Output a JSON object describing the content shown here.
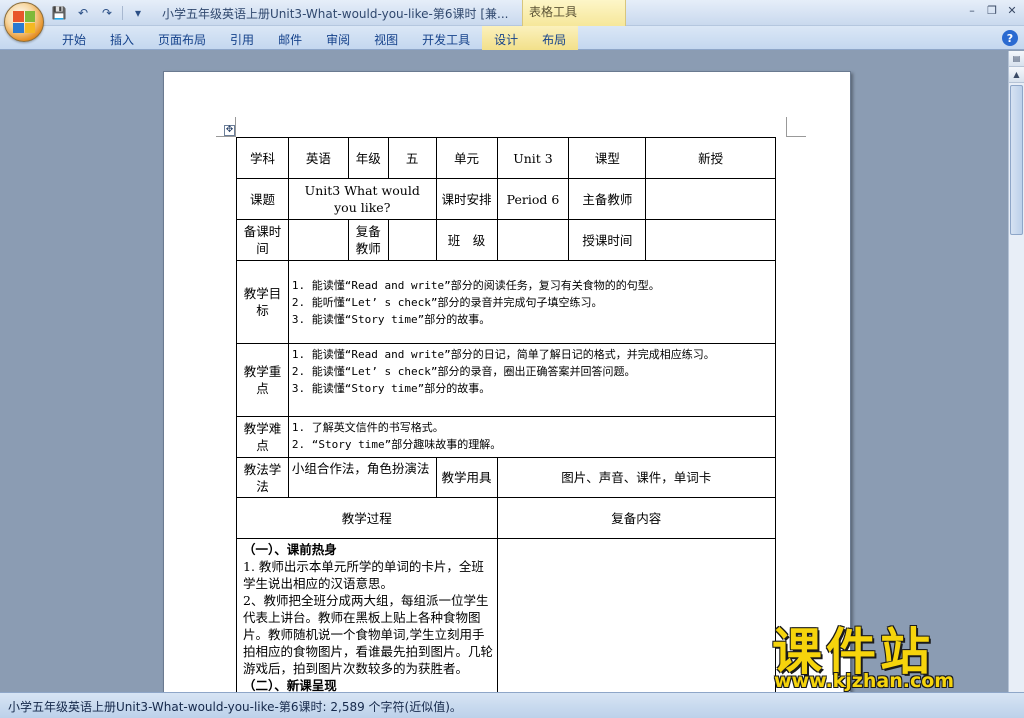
{
  "app": {
    "title": "小学五年级英语上册Unit3-What-would-you-like-第6课时 [兼...",
    "context_tab_group": "表格工具"
  },
  "ribbon": {
    "tabs": [
      "开始",
      "插入",
      "页面布局",
      "引用",
      "邮件",
      "审阅",
      "视图",
      "开发工具",
      "设计",
      "布局"
    ]
  },
  "table": {
    "subject_label": "学科",
    "subject_value": "英语",
    "grade_label": "年级",
    "grade_value": "五",
    "unit_label": "单元",
    "unit_value": "Unit 3",
    "type_label": "课型",
    "type_value": "新授",
    "topic_label": "课题",
    "topic_value": "Unit3 What would you like?",
    "period_label": "课时安排",
    "period_value": "Period 6",
    "teacher_label": "主备教师",
    "prep_time_label": "备课时间",
    "review_teacher_label": "复备教师",
    "class_label": "班　级",
    "teach_time_label": "授课时间",
    "goals_label": "教学目标",
    "goals": [
      "1. 能读懂“Read and write”部分的阅读任务，复习有关食物的的句型。",
      "2. 能听懂“Let’ s check”部分的录音并完成句子填空练习。",
      "3. 能读懂“Story time”部分的故事。"
    ],
    "key_points_label": "教学重点",
    "key_points": [
      "1. 能读懂“Read and write”部分的日记，简单了解日记的格式，并完成相应练习。",
      "2. 能读懂“Let’ s check”部分的录音，圈出正确答案并回答问题。",
      "3. 能读懂“Story time”部分的故事。"
    ],
    "difficulties_label": "教学难点",
    "difficulties": [
      "1. 了解英文信件的书写格式。",
      "2. “Story time”部分趣味故事的理解。"
    ],
    "method_label": "教法学法",
    "method_value": "小组合作法，角色扮演法",
    "tools_label": "教学用具",
    "tools_value": "图片、声音、课件，单词卡",
    "process_label": "教学过程",
    "review_label": "复备内容",
    "section1_title": "（一）、课前热身",
    "section1_p1": "1. 教师出示本单元所学的单词的卡片，全班学生说出相应的汉语意思。",
    "section1_p2": "2、教师把全班分成两大组，每组派一位学生代表上讲台。教师在黑板上贴上各种食物图片。教师随机说一个食物单词,学生立刻用手拍相应的食物图片，看谁最先拍到图片。几轮游戏后，拍到图片次数较多的为获胜者。",
    "section2_title": "（二）、新课呈现"
  },
  "status": {
    "text": "小学五年级英语上册Unit3-What-would-you-like-第6课时: 2,589 个字符(近似值)。"
  },
  "watermark": {
    "brand": "课件站",
    "url": "www.kjzhan.com"
  }
}
